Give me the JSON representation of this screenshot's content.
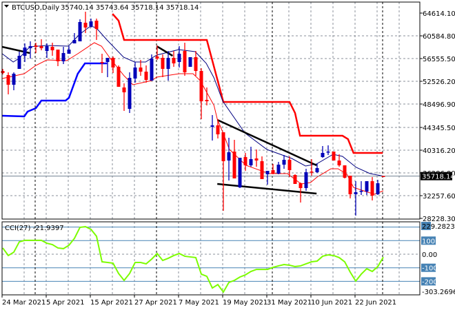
{
  "header": {
    "symbol_label": "BTCUSD,Daily",
    "ohlc_text": "35740.14 35743.64 35718.14 35718.14"
  },
  "colors": {
    "bull": "#0000b8",
    "bear": "#ff0000",
    "fast_ma": "#000080",
    "slow_ma": "#ff0000",
    "resistance_step": "#ff0000",
    "support_step": "#0000ff",
    "trendline": "#000000",
    "cci": "#7cfc00",
    "cci_level": "#4682b4",
    "grid": "#8a8f99"
  },
  "chart_data": [
    {
      "type": "candlestick",
      "title": "BTCUSD,Daily",
      "ylim": [
        28228.3,
        64614.1
      ],
      "price_ticks": [
        "64614.10",
        "60584.80",
        "56555.50",
        "52526.20",
        "48496.90",
        "44345.50",
        "40316.20",
        "36286.90",
        "32257.60",
        "28228.30"
      ],
      "price_tick_values": [
        64614.1,
        60584.8,
        56555.5,
        52526.2,
        48496.9,
        44345.5,
        40316.2,
        36286.9,
        32257.6,
        28228.3
      ],
      "current_price_label": "35718.14",
      "current_price": 35718.14,
      "date_labels": [
        "24 Mar 2021",
        "5 Apr 2021",
        "15 Apr 2021",
        "27 Apr 2021",
        "7 May 2021",
        "19 May 2021",
        "31 May 2021",
        "10 Jun 2021",
        "22 Jun 2021"
      ],
      "date_label_candle_index": [
        0,
        8,
        16,
        24,
        32,
        40,
        48,
        56,
        64
      ],
      "period_separator_candle_index": [
        6,
        28,
        49,
        69
      ],
      "candles_ohlc": [
        [
          54358,
          54724,
          53747,
          53991
        ],
        [
          53625,
          54113,
          50206,
          51916
        ],
        [
          51916,
          54113,
          50939,
          53869
        ],
        [
          54724,
          57776,
          54724,
          57044
        ],
        [
          57044,
          59242,
          55945,
          58509
        ],
        [
          58387,
          59608,
          56555,
          58753
        ],
        [
          58875,
          59364,
          57532,
          58631
        ],
        [
          58753,
          59974,
          58021,
          58387
        ],
        [
          57898,
          59242,
          56678,
          58753
        ],
        [
          58631,
          59364,
          57044,
          58021
        ],
        [
          58143,
          58143,
          55212,
          56067
        ],
        [
          56067,
          58631,
          55579,
          57532
        ],
        [
          57410,
          58753,
          57410,
          58143
        ],
        [
          59242,
          61073,
          59242,
          59852
        ],
        [
          59608,
          63515,
          59608,
          63027
        ],
        [
          62905,
          64858,
          61073,
          62050
        ],
        [
          62294,
          63637,
          62050,
          63149
        ],
        [
          63271,
          63637,
          59852,
          61806
        ],
        [
          55945,
          57410,
          53991,
          55823
        ],
        [
          55945,
          56678,
          53259,
          56678
        ],
        [
          56678,
          56922,
          53991,
          54968
        ],
        [
          55090,
          55334,
          51550,
          51550
        ],
        [
          51427,
          52160,
          47276,
          50572
        ],
        [
          47642,
          54113,
          46910,
          53137
        ],
        [
          53015,
          55945,
          52282,
          54968
        ],
        [
          54968,
          56311,
          53503,
          54236
        ],
        [
          54236,
          55334,
          52282,
          52770
        ],
        [
          52648,
          57288,
          52648,
          56555
        ],
        [
          56922,
          58875,
          56311,
          56555
        ],
        [
          56678,
          57288,
          53259,
          54724
        ],
        [
          54724,
          57898,
          52648,
          56678
        ],
        [
          56678,
          57898,
          55090,
          55701
        ],
        [
          55945,
          58753,
          54968,
          57410
        ],
        [
          57898,
          59364,
          53503,
          54113
        ],
        [
          55090,
          56800,
          55090,
          56800
        ],
        [
          56800,
          57898,
          53503,
          54358
        ],
        [
          54358,
          54846,
          45811,
          48985
        ],
        [
          49229,
          51427,
          48253,
          48985
        ],
        [
          44467,
          46543,
          42025,
          44712
        ],
        [
          44712,
          45811,
          42392,
          43124
        ],
        [
          43491,
          43491,
          29573,
          38362
        ],
        [
          38484,
          42514,
          34945,
          39949
        ],
        [
          40071,
          42147,
          35311,
          35311
        ],
        [
          33724,
          38973,
          33602,
          38973
        ],
        [
          39095,
          39827,
          36653,
          37630
        ],
        [
          37630,
          40926,
          37386,
          38729
        ],
        [
          38851,
          40438,
          37386,
          38484
        ],
        [
          38362,
          39217,
          35189,
          35189
        ],
        [
          36043,
          36653,
          34212,
          36653
        ],
        [
          36775,
          37874,
          36043,
          36165
        ],
        [
          36165,
          38240,
          36043,
          37752
        ],
        [
          37752,
          39461,
          37020,
          38607
        ],
        [
          38607,
          39217,
          35555,
          36775
        ],
        [
          35921,
          36043,
          34334,
          34334
        ],
        [
          34457,
          34579,
          31039,
          33602
        ],
        [
          33602,
          37020,
          33114,
          36409
        ],
        [
          36531,
          38729,
          35799,
          36470
        ],
        [
          36409,
          37874,
          36287,
          37142
        ],
        [
          39095,
          41049,
          38973,
          39827
        ],
        [
          40010,
          41171,
          39461,
          40071
        ],
        [
          40071,
          40071,
          38484,
          38484
        ],
        [
          38484,
          39583,
          37386,
          37630
        ],
        [
          37630,
          37630,
          35311,
          35433
        ],
        [
          35799,
          35799,
          31771,
          32504
        ],
        [
          32504,
          34823,
          28718,
          32870
        ],
        [
          33054,
          34823,
          32381,
          33114
        ],
        [
          32992,
          34823,
          32381,
          34823
        ],
        [
          34823,
          35555,
          31405,
          32259
        ],
        [
          32504,
          35067,
          32381,
          34457
        ],
        [
          35740.14,
          35743.64,
          35718.14,
          35718.14
        ]
      ],
      "fast_ma_points": [
        [
          -0.1,
          57410
        ],
        [
          1.9,
          55945
        ],
        [
          2.9,
          56555
        ],
        [
          4.9,
          58631
        ],
        [
          7.9,
          58875
        ],
        [
          11.9,
          58753
        ],
        [
          13.9,
          60829
        ],
        [
          15.9,
          62294
        ],
        [
          16.9,
          62050
        ],
        [
          18.9,
          59852
        ],
        [
          21.9,
          56800
        ],
        [
          23.9,
          55945
        ],
        [
          25.9,
          55945
        ],
        [
          27.9,
          57166
        ],
        [
          31.9,
          58143
        ],
        [
          34.9,
          57776
        ],
        [
          36.9,
          55701
        ],
        [
          38.3,
          53137
        ],
        [
          39.9,
          48985
        ],
        [
          43.9,
          43369
        ],
        [
          47.9,
          40438
        ],
        [
          52.4,
          38851
        ],
        [
          54.9,
          37508
        ],
        [
          56.9,
          37874
        ],
        [
          59.9,
          39583
        ],
        [
          61.6,
          39217
        ],
        [
          64.1,
          37264
        ],
        [
          66.6,
          36165
        ],
        [
          68.6,
          35799
        ],
        [
          69,
          35718
        ]
      ],
      "slow_ma_points": [
        [
          -0.1,
          53015
        ],
        [
          3.9,
          53869
        ],
        [
          6.0,
          55334
        ],
        [
          8.0,
          56311
        ],
        [
          11.6,
          56189
        ],
        [
          13.6,
          57410
        ],
        [
          16.6,
          59364
        ],
        [
          17.9,
          58753
        ],
        [
          19.5,
          56555
        ],
        [
          22.0,
          53503
        ],
        [
          23.6,
          51916
        ],
        [
          27.0,
          52648
        ],
        [
          27.9,
          53259
        ],
        [
          32.0,
          53869
        ],
        [
          34.5,
          53869
        ],
        [
          35.8,
          52648
        ],
        [
          38.3,
          48253
        ],
        [
          38.9,
          45811
        ],
        [
          39.9,
          43491
        ],
        [
          41.1,
          40438
        ],
        [
          44.1,
          37630
        ],
        [
          48.3,
          36165
        ],
        [
          51.6,
          36165
        ],
        [
          54.1,
          34334
        ],
        [
          55.8,
          34579
        ],
        [
          57.0,
          35555
        ],
        [
          59.5,
          37020
        ],
        [
          60.8,
          37020
        ],
        [
          62.4,
          36043
        ],
        [
          63.6,
          33724
        ],
        [
          65.8,
          32992
        ],
        [
          67.4,
          32504
        ],
        [
          69.0,
          33114
        ]
      ],
      "resistance_step_points": [
        [
          19.9,
          64490
        ],
        [
          21,
          63270
        ],
        [
          22,
          59850
        ],
        [
          37,
          59850
        ],
        [
          40,
          48860
        ],
        [
          52,
          48860
        ],
        [
          53,
          46910
        ],
        [
          53.9,
          42880
        ],
        [
          61.6,
          42880
        ],
        [
          62.6,
          42270
        ],
        [
          63.6,
          39830
        ],
        [
          68.9,
          39830
        ]
      ],
      "support_step_points": [
        [
          -0.1,
          46420
        ],
        [
          3.9,
          46300
        ],
        [
          4.5,
          47150
        ],
        [
          6,
          47760
        ],
        [
          7,
          49110
        ],
        [
          11.4,
          49110
        ],
        [
          12,
          49600
        ],
        [
          13.6,
          53870
        ],
        [
          14.9,
          55700
        ],
        [
          18.9,
          55700
        ]
      ],
      "trendlines": [
        [
          [
            -0.1,
            58631
          ],
          [
            4.9,
            57532
          ]
        ],
        [
          [
            27.9,
            58753
          ],
          [
            30.8,
            57044
          ]
        ],
        [
          [
            38.9,
            45689
          ],
          [
            56.9,
            37630
          ]
        ],
        [
          [
            38.9,
            34334
          ],
          [
            56.9,
            32625
          ]
        ]
      ]
    },
    {
      "type": "line",
      "title": "CCI(27)",
      "indicator_label": "CCI(27) -21.9397",
      "ylim": [
        -303.2696,
        229.2823
      ],
      "axis_labels": [
        "229.2823",
        "100",
        "0.00",
        "-100",
        "-200",
        "-303.2696"
      ],
      "axis_label_values": [
        229.2823,
        100,
        0,
        -100,
        -200,
        -303.2696
      ],
      "axis_label_boxed": [
        true,
        true,
        false,
        true,
        true,
        false
      ],
      "level_lines": [
        200,
        100,
        -100,
        -200
      ],
      "values": [
        46,
        -10,
        15,
        91,
        102,
        102,
        102,
        102,
        81,
        71,
        46,
        41,
        66,
        117,
        198,
        203,
        183,
        132,
        -56,
        -61,
        -66,
        -142,
        -193,
        -142,
        -61,
        -61,
        -71,
        -36,
        5,
        -46,
        -30,
        -10,
        5,
        -15,
        -20,
        -25,
        -147,
        -163,
        -249,
        -224,
        -279,
        -208,
        -193,
        -168,
        -152,
        -127,
        -112,
        -112,
        -112,
        -97,
        -86,
        -76,
        -81,
        -91,
        -86,
        -71,
        -56,
        -51,
        -15,
        -5,
        -10,
        -25,
        -56,
        -132,
        -198,
        -147,
        -107,
        -127,
        -91,
        -21.94
      ]
    }
  ]
}
